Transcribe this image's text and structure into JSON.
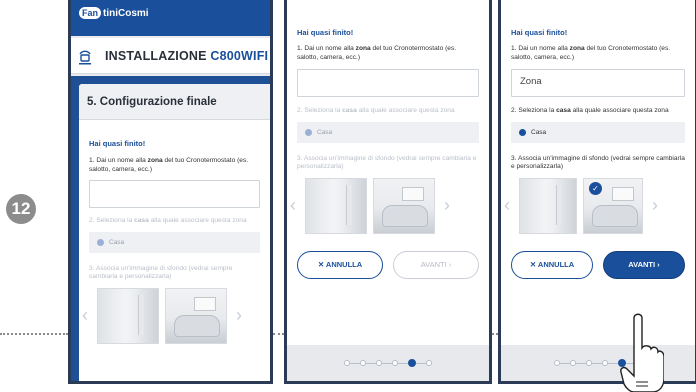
{
  "step_badge": "12",
  "brand": {
    "mark": "Fan",
    "rest": "tiniCosmi"
  },
  "install": {
    "title": "INSTALLAZIONE",
    "model": "C800WIFI"
  },
  "section_title": "5. Configurazione finale",
  "finish_heading": "Hai quasi finito!",
  "step1": {
    "prefix": "1. Dai un nome alla ",
    "bold": "zona",
    "suffix": " del tuo Cronotermostato (es. salotto, camera, ecc.)"
  },
  "step2": {
    "prefix": "2. Seleziona la ",
    "bold": "casa",
    "suffix": " alla quale associare questa zona"
  },
  "step3": {
    "text": "3. Associa un'immagine di sfondo (vedrai sempre cambiarla e personalizzarla)"
  },
  "zone_input": {
    "value": "Zona"
  },
  "house_option": "Casa",
  "buttons": {
    "cancel": "✕ ANNULLA",
    "next": "AVANTI ›"
  },
  "colors": {
    "brand_blue": "#1a4f9b",
    "badge_grey": "#8c8c8c"
  }
}
